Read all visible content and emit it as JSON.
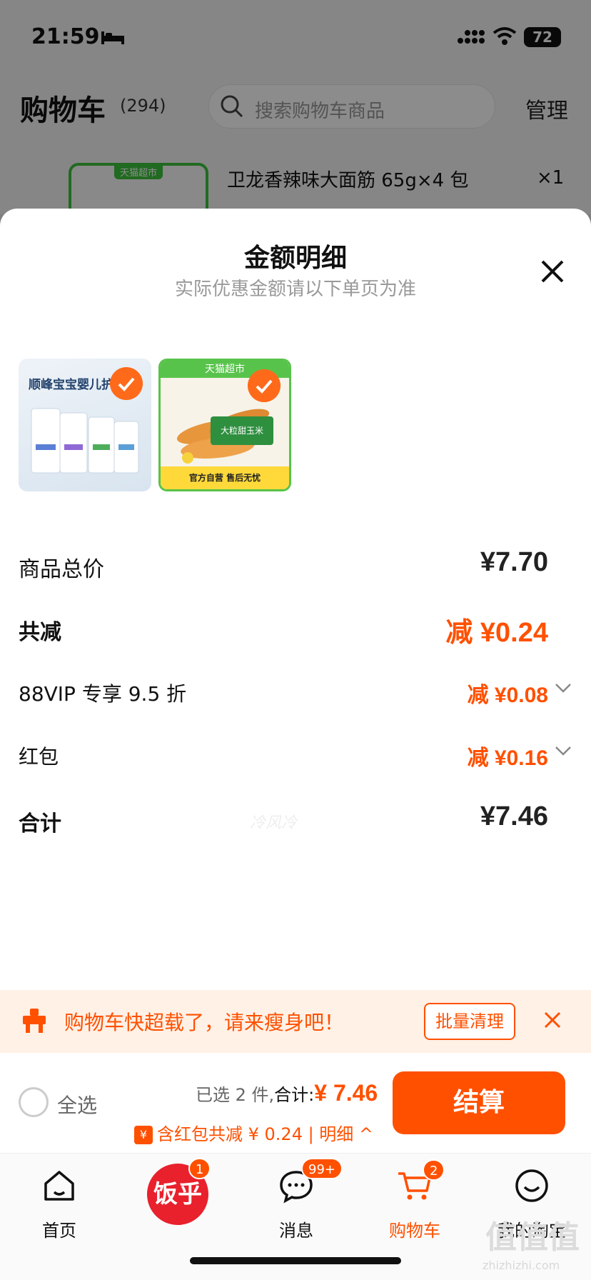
{
  "status_bar": {
    "time": "21:59",
    "battery": "72"
  },
  "background_cart": {
    "title": "购物车",
    "count": "(294)",
    "search_placeholder": "搜索购物车商品",
    "manage_label": "管理",
    "item_store_tag": "天猫超市",
    "item_name": "卫龙香辣味大面筋 65g×4 包",
    "item_qty": "×1"
  },
  "sheet": {
    "title": "金额明细",
    "subtitle": "实际优惠金额请以下单页为准",
    "thumbnails": [
      {
        "caption": "顺峰宝宝婴儿护肤"
      },
      {
        "tag": "天猫超市",
        "mid": "大粒甜玉米",
        "bottom": "官方自营 售后无忧"
      }
    ],
    "rows": {
      "subtotal": {
        "label": "商品总价",
        "value": "¥7.70"
      },
      "discount": {
        "label": "共减",
        "value": "减 ¥0.24"
      },
      "vip": {
        "label": "88VIP 专享 9.5 折",
        "value": "减 ¥0.08"
      },
      "red_packet": {
        "label": "红包",
        "value": "减 ¥0.16"
      },
      "total": {
        "label": "合计",
        "value": "¥7.46"
      }
    },
    "watermark": "冷风冷"
  },
  "warning": {
    "text": "购物车快超载了，请来瘦身吧！",
    "button": "批量清理"
  },
  "checkout": {
    "select_all": "全选",
    "selected_prefix": "已选 2 件,",
    "sum_label": "合计:",
    "sum_value": "¥ 7.46",
    "red_packet_line": "含红包共减 ¥ 0.24 | 明细 ^",
    "red_packet_icon": "¥",
    "button": "结算"
  },
  "tabbar": {
    "tabs": [
      {
        "label": "首页",
        "icon": "home-icon"
      },
      {
        "label": "",
        "icon": "fan-logo",
        "logo_text": "饭乎",
        "badge": "1"
      },
      {
        "label": "消息",
        "icon": "message-icon",
        "badge": "99+"
      },
      {
        "label": "购物车",
        "icon": "cart-icon",
        "badge": "2"
      },
      {
        "label": "我的淘宝",
        "icon": "profile-icon"
      }
    ]
  },
  "site_watermark": {
    "logo": "值值值",
    "url": "zhizhizhi.com"
  },
  "colors": {
    "accent": "#ff5000",
    "tmall_green": "#58c34b"
  }
}
